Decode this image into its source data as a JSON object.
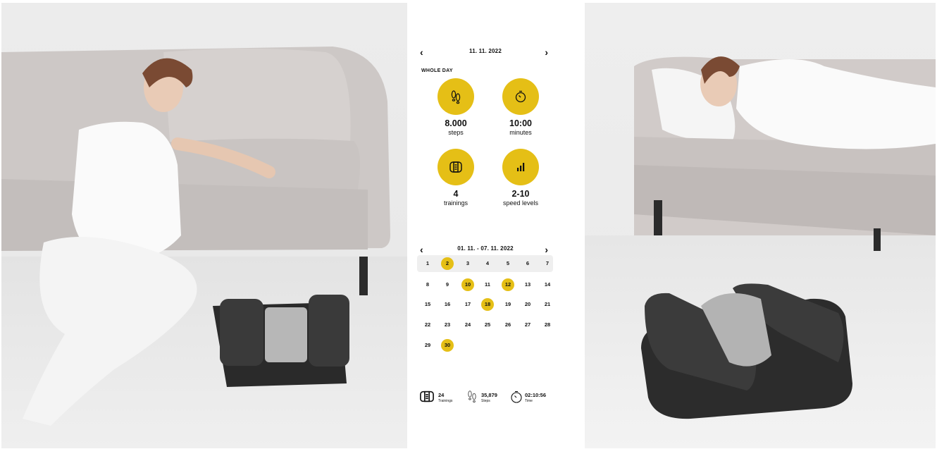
{
  "day_card": {
    "nav_prev": "‹",
    "nav_next": "›",
    "date": "11. 11. 2022",
    "section": "WHOLE DAY",
    "stats": [
      {
        "value": "8.000",
        "unit": "steps",
        "icon": "footprints-icon"
      },
      {
        "value": "10:00",
        "unit": "minutes",
        "icon": "timer-icon"
      },
      {
        "value": "4",
        "unit": "trainings",
        "icon": "stepper-device-icon"
      },
      {
        "value": "2-10",
        "unit": "speed levels",
        "icon": "speed-bars-icon"
      }
    ]
  },
  "week_card": {
    "nav_prev": "‹",
    "nav_next": "›",
    "date_range": "01. 11. - 07. 11. 2022",
    "weeks": [
      [
        "1",
        "2",
        "3",
        "4",
        "5",
        "6",
        "7"
      ],
      [
        "8",
        "9",
        "10",
        "11",
        "12",
        "13",
        "14"
      ],
      [
        "15",
        "16",
        "17",
        "18",
        "19",
        "20",
        "21"
      ],
      [
        "22",
        "23",
        "24",
        "25",
        "26",
        "27",
        "28"
      ],
      [
        "29",
        "30"
      ]
    ],
    "active_days": [
      "2",
      "10",
      "12",
      "18",
      "30"
    ],
    "summary": {
      "trainings_value": "24",
      "trainings_label": "Trainings",
      "steps_value": "35,879",
      "steps_label": "Steps",
      "time_value": "02:10:56",
      "time_label": "Time"
    }
  },
  "colors": {
    "accent": "#e5bf16",
    "row_highlight": "#efefef",
    "text": "#111111"
  }
}
